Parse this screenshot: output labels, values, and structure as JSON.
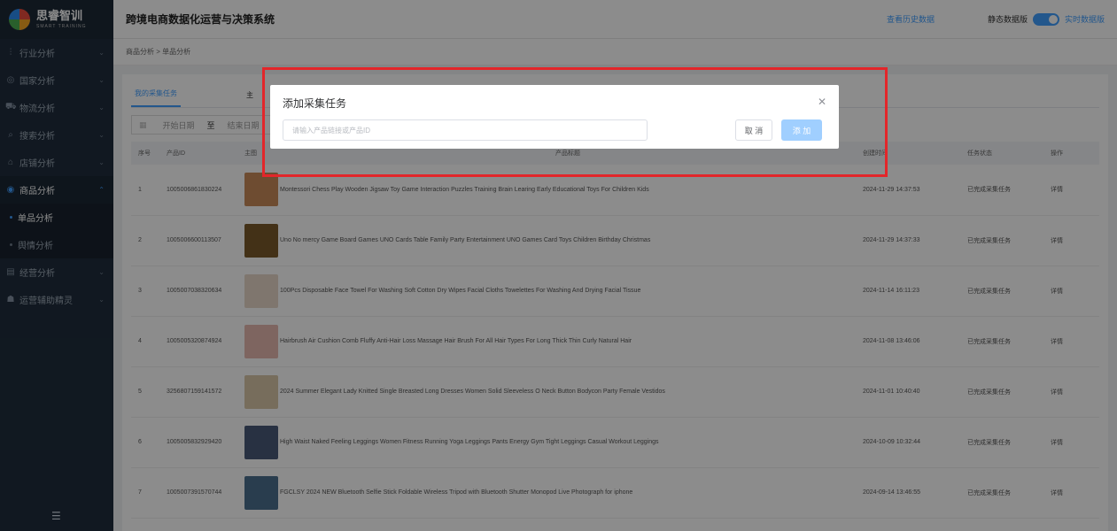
{
  "brand": {
    "name": "思睿智训",
    "subtitle": "SMART TRAINING"
  },
  "header": {
    "title": "跨境电商数据化运营与决策系统",
    "history_link": "查看历史数据",
    "static_label": "静态数据版",
    "realtime_label": "实时数据版",
    "realtime_enabled": true
  },
  "sidebar": {
    "items": [
      {
        "label": "行业分析",
        "icon": "chart-icon"
      },
      {
        "label": "国家分析",
        "icon": "globe-icon"
      },
      {
        "label": "物流分析",
        "icon": "truck-icon"
      },
      {
        "label": "搜索分析",
        "icon": "search-icon"
      },
      {
        "label": "店铺分析",
        "icon": "shop-icon"
      },
      {
        "label": "商品分析",
        "icon": "box-icon"
      },
      {
        "label": "经营分析",
        "icon": "report-icon"
      },
      {
        "label": "运营辅助精灵",
        "icon": "assistant-icon"
      }
    ],
    "sub_items": [
      {
        "label": "单品分析"
      },
      {
        "label": "舆情分析"
      }
    ]
  },
  "breadcrumb": "商品分析 > 单品分析",
  "tabs": [
    {
      "label": "我的采集任务"
    },
    {
      "label": "主"
    }
  ],
  "filters": {
    "start_date": "开始日期",
    "to": "至",
    "end_date": "结束日期"
  },
  "table": {
    "headers": {
      "index": "序号",
      "product_id": "产品ID",
      "image": "主图",
      "title": "产品标题",
      "created": "创建时间",
      "status": "任务状态",
      "op": "操作"
    },
    "rows": [
      {
        "index": "1",
        "product_id": "1005006861830224",
        "title": "Montessori Chess Play Wooden Jigsaw Toy Game Interaction Puzzles Training Brain Learing Early Educational Toys For Children Kids",
        "created": "2024-11-29 14:37:53",
        "status": "已完成采集任务",
        "op": "详情",
        "thumb_color": "#c98a5a"
      },
      {
        "index": "2",
        "product_id": "1005006600113507",
        "title": "Uno No mercy Game Board Games UNO Cards Table Family Party Entertainment UNO Games Card Toys Children Birthday Christmas",
        "created": "2024-11-29 14:37:33",
        "status": "已完成采集任务",
        "op": "详情",
        "thumb_color": "#7a5a2a"
      },
      {
        "index": "3",
        "product_id": "1005007038320634",
        "title": "100Pcs Disposable Face Towel For Washing Soft Cotton Dry Wipes Facial Cloths Towelettes For Washing And Drying Facial Tissue",
        "created": "2024-11-14 16:11:23",
        "status": "已完成采集任务",
        "op": "详情",
        "thumb_color": "#e8d8c8"
      },
      {
        "index": "4",
        "product_id": "1005005320874924",
        "title": "Hairbrush Air Cushion Comb Fluffy Anti-Hair Loss Massage Hair Brush For All Hair Types For Long Thick Thin Curly Natural Hair",
        "created": "2024-11-08 13:46:06",
        "status": "已完成采集任务",
        "op": "详情",
        "thumb_color": "#e6b8b0"
      },
      {
        "index": "5",
        "product_id": "3256807159141572",
        "title": "2024 Summer Elegant Lady Knitted Single Breasted Long Dresses Women Solid Sleeveless O Neck Button Bodycon Party Female Vestidos",
        "created": "2024-11-01 10:40:40",
        "status": "已完成采集任务",
        "op": "详情",
        "thumb_color": "#d9c7a8"
      },
      {
        "index": "6",
        "product_id": "1005005832929420",
        "title": "High Waist Naked Feeling Leggings Women Fitness Running Yoga Leggings Pants Energy Gym Tight Leggings Casual Workout Leggings",
        "created": "2024-10-09 10:32:44",
        "status": "已完成采集任务",
        "op": "详情",
        "thumb_color": "#4a5a78"
      },
      {
        "index": "7",
        "product_id": "1005007391570744",
        "title": "FGCLSY 2024 NEW Bluetooth Selfie Stick Foldable Wireless Tripod with Bluetooth Shutter Monopod Live Photograph for iphone",
        "created": "2024-09-14 13:46:55",
        "status": "已完成采集任务",
        "op": "详情",
        "thumb_color": "#4b6f8f"
      }
    ]
  },
  "dialog": {
    "title": "添加采集任务",
    "input_placeholder": "请输入产品链接或产品ID",
    "input_value": "",
    "cancel_label": "取 消",
    "add_label": "添 加"
  }
}
